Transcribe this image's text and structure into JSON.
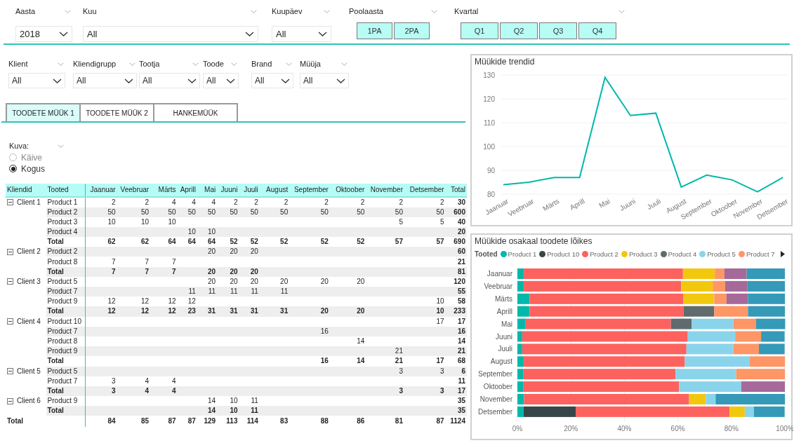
{
  "top_slicers": [
    {
      "kind": "dropdown",
      "label": "Aasta",
      "value": "2018"
    },
    {
      "kind": "dropdown",
      "label": "Kuu",
      "value": "All"
    },
    {
      "kind": "dropdown",
      "label": "Kuupäev",
      "value": "All"
    },
    {
      "kind": "buttons",
      "label": "Poolaasta",
      "buttons": [
        "1PA",
        "2PA"
      ]
    },
    {
      "kind": "buttons",
      "label": "Kvartal",
      "buttons": [
        "Q1",
        "Q2",
        "Q3",
        "Q4"
      ]
    }
  ],
  "filter_slicers": [
    {
      "label": "Klient",
      "value": "All"
    },
    {
      "label": "Kliendigrupp",
      "value": "All"
    },
    {
      "label": "Tootja",
      "value": "All"
    },
    {
      "label": "Toode",
      "value": "All"
    },
    {
      "label": "Brand",
      "value": "All"
    },
    {
      "label": "Müüja",
      "value": "All"
    }
  ],
  "tabs": [
    {
      "label": "TOODETE MÜÜK 1",
      "selected": true
    },
    {
      "label": "TOODETE MÜÜK 2",
      "selected": false
    },
    {
      "label": "HANKEMÜÜK",
      "selected": false
    }
  ],
  "view_slicer": {
    "label": "Kuva:",
    "options": [
      {
        "label": "Käive",
        "selected": false
      },
      {
        "label": "Kogus",
        "selected": true
      }
    ]
  },
  "table": {
    "columns": [
      "Kliendid",
      "Tooted",
      "Jaanuar",
      "Veebruar",
      "Märts",
      "Aprill",
      "Mai",
      "Juuni",
      "Juuli",
      "August",
      "September",
      "Oktoober",
      "November",
      "Detsember",
      "Total"
    ],
    "groups": [
      {
        "client": "Client 1",
        "expanded": true,
        "rows": [
          {
            "kind": "product",
            "cells": [
              "Product 1",
              "2",
              "2",
              "4",
              "4",
              "4",
              "2",
              "2",
              "2",
              "2",
              "2",
              "2",
              "2",
              "30"
            ]
          },
          {
            "kind": "product",
            "cells": [
              "Product 2",
              "50",
              "50",
              "50",
              "50",
              "50",
              "50",
              "50",
              "50",
              "50",
              "50",
              "50",
              "50",
              "600"
            ]
          },
          {
            "kind": "product",
            "cells": [
              "Product 3",
              "10",
              "10",
              "10",
              "",
              "",
              "",
              "",
              "",
              "",
              "",
              "5",
              "5",
              "40"
            ]
          },
          {
            "kind": "product",
            "cells": [
              "Product 4",
              "",
              "",
              "",
              "10",
              "10",
              "",
              "",
              "",
              "",
              "",
              "",
              "",
              "20"
            ]
          },
          {
            "kind": "total",
            "cells": [
              "Total",
              "62",
              "62",
              "64",
              "64",
              "64",
              "52",
              "52",
              "52",
              "52",
              "52",
              "57",
              "57",
              "690"
            ]
          }
        ]
      },
      {
        "client": "Client 2",
        "expanded": true,
        "rows": [
          {
            "kind": "product",
            "cells": [
              "Product 2",
              "",
              "",
              "",
              "",
              "20",
              "20",
              "20",
              "",
              "",
              "",
              "",
              "",
              "60"
            ]
          },
          {
            "kind": "product",
            "cells": [
              "Product 8",
              "7",
              "7",
              "7",
              "",
              "",
              "",
              "",
              "",
              "",
              "",
              "",
              "",
              "21"
            ]
          },
          {
            "kind": "total",
            "cells": [
              "Total",
              "7",
              "7",
              "7",
              "",
              "20",
              "20",
              "20",
              "",
              "",
              "",
              "",
              "",
              "81"
            ]
          }
        ]
      },
      {
        "client": "Client 3",
        "expanded": true,
        "rows": [
          {
            "kind": "product",
            "cells": [
              "Product 5",
              "",
              "",
              "",
              "",
              "20",
              "20",
              "20",
              "20",
              "20",
              "20",
              "",
              "",
              "120"
            ]
          },
          {
            "kind": "product",
            "cells": [
              "Product 7",
              "",
              "",
              "",
              "11",
              "11",
              "11",
              "11",
              "11",
              "",
              "",
              "",
              "",
              "55"
            ]
          },
          {
            "kind": "product",
            "cells": [
              "Product 9",
              "12",
              "12",
              "12",
              "12",
              "",
              "",
              "",
              "",
              "",
              "",
              "",
              "10",
              "58"
            ]
          },
          {
            "kind": "total",
            "cells": [
              "Total",
              "12",
              "12",
              "12",
              "23",
              "31",
              "31",
              "31",
              "31",
              "20",
              "20",
              "",
              "10",
              "233"
            ]
          }
        ]
      },
      {
        "client": "Client 4",
        "expanded": true,
        "rows": [
          {
            "kind": "product",
            "cells": [
              "Product 10",
              "",
              "",
              "",
              "",
              "",
              "",
              "",
              "",
              "",
              "",
              "",
              "17",
              "17"
            ]
          },
          {
            "kind": "product",
            "cells": [
              "Product 7",
              "",
              "",
              "",
              "",
              "",
              "",
              "",
              "",
              "16",
              "",
              "",
              "",
              "16"
            ]
          },
          {
            "kind": "product",
            "cells": [
              "Product 8",
              "",
              "",
              "",
              "",
              "",
              "",
              "",
              "",
              "",
              "14",
              "",
              "",
              "14"
            ]
          },
          {
            "kind": "product",
            "cells": [
              "Product 9",
              "",
              "",
              "",
              "",
              "",
              "",
              "",
              "",
              "",
              "",
              "21",
              "",
              "21"
            ]
          },
          {
            "kind": "total",
            "cells": [
              "Total",
              "",
              "",
              "",
              "",
              "",
              "",
              "",
              "",
              "16",
              "14",
              "21",
              "17",
              "68"
            ]
          }
        ]
      },
      {
        "client": "Client 5",
        "expanded": true,
        "rows": [
          {
            "kind": "product",
            "cells": [
              "Product 5",
              "",
              "",
              "",
              "",
              "",
              "",
              "",
              "",
              "",
              "",
              "3",
              "3",
              "6"
            ]
          },
          {
            "kind": "product",
            "cells": [
              "Product 7",
              "3",
              "4",
              "4",
              "",
              "",
              "",
              "",
              "",
              "",
              "",
              "",
              "",
              "11"
            ]
          },
          {
            "kind": "total",
            "cells": [
              "Total",
              "3",
              "4",
              "4",
              "",
              "",
              "",
              "",
              "",
              "",
              "",
              "3",
              "3",
              "17"
            ]
          }
        ]
      },
      {
        "client": "Client 6",
        "expanded": true,
        "rows": [
          {
            "kind": "product",
            "cells": [
              "Product 9",
              "",
              "",
              "",
              "",
              "14",
              "10",
              "11",
              "",
              "",
              "",
              "",
              "",
              "35"
            ]
          },
          {
            "kind": "total",
            "cells": [
              "Total",
              "",
              "",
              "",
              "",
              "14",
              "10",
              "11",
              "",
              "",
              "",
              "",
              "",
              "35"
            ]
          }
        ]
      }
    ],
    "grand_total": {
      "label": "Total",
      "cells": [
        "84",
        "85",
        "87",
        "87",
        "129",
        "113",
        "114",
        "83",
        "88",
        "86",
        "81",
        "87",
        "1124"
      ]
    }
  },
  "trend_chart": {
    "title": "Müükide trendid",
    "chart_data": {
      "type": "line",
      "categories": [
        "Jaanuar",
        "Veebruar",
        "Märts",
        "Aprill",
        "Mai",
        "Juuni",
        "Juuli",
        "August",
        "September",
        "Oktoober",
        "November",
        "Detsember"
      ],
      "series": [
        {
          "color": "#01b8aa",
          "values": [
            84,
            85,
            87,
            87,
            129,
            113,
            114,
            83,
            88,
            86,
            81,
            87
          ]
        }
      ],
      "ylim": [
        80,
        130
      ],
      "grid": true,
      "yticks": [
        80,
        90,
        100,
        110,
        120,
        130
      ]
    }
  },
  "share_chart": {
    "title": "Müükide osakaal toodete lõikes",
    "legend_title": "Tooted",
    "chart_data": {
      "type": "bar",
      "orientation": "horizontal",
      "stacked": true,
      "categories": [
        "Jaanuar",
        "Veebruar",
        "Märts",
        "Aprill",
        "Mai",
        "Juuni",
        "Juuli",
        "August",
        "September",
        "Oktoober",
        "November",
        "Detsember"
      ],
      "series": [
        {
          "name": "Product 1",
          "color": "#01b8aa",
          "values": [
            2.4,
            2.4,
            4.6,
            4.6,
            3.1,
            1.8,
            1.8,
            2.4,
            2.3,
            2.3,
            2.5,
            2.3
          ]
        },
        {
          "name": "Product 10",
          "color": "#374649",
          "values": [
            null,
            null,
            null,
            null,
            null,
            null,
            null,
            null,
            null,
            null,
            null,
            19.5
          ]
        },
        {
          "name": "Product 2",
          "color": "#fd625e",
          "values": [
            59.5,
            58.8,
            57.5,
            57.5,
            54.3,
            61.9,
            61.4,
            60.2,
            56.8,
            58.1,
            61.7,
            57.5
          ]
        },
        {
          "name": "Product 3",
          "color": "#f2c80f",
          "values": [
            11.9,
            11.8,
            11.5,
            null,
            null,
            null,
            null,
            null,
            null,
            null,
            6.2,
            5.7
          ]
        },
        {
          "name": "Product 4",
          "color": "#5f6b6d",
          "values": [
            null,
            null,
            null,
            11.5,
            7.8,
            null,
            null,
            null,
            null,
            null,
            null,
            null
          ]
        },
        {
          "name": "Product 5",
          "color": "#8ad4eb",
          "values": [
            null,
            null,
            null,
            null,
            15.5,
            17.7,
            17.5,
            24.1,
            22.7,
            23.3,
            3.7,
            3.4
          ]
        },
        {
          "name": "Product 7",
          "color": "#fe9666",
          "values": [
            3.6,
            4.7,
            4.6,
            12.6,
            8.5,
            9.7,
            9.6,
            13.3,
            18.2,
            null,
            null,
            null
          ]
        },
        {
          "color": "#a66999",
          "values": [
            8.3,
            8.2,
            8.0,
            null,
            null,
            null,
            null,
            null,
            null,
            16.3,
            null,
            null
          ]
        },
        {
          "color": "#3599b8",
          "values": [
            14.3,
            14.1,
            13.8,
            13.8,
            10.9,
            8.8,
            9.6,
            null,
            null,
            null,
            25.9,
            11.5
          ]
        }
      ],
      "xlim": [
        0,
        100
      ],
      "grid": true,
      "xticks": [
        {
          "value": 0,
          "label": "0%"
        },
        {
          "value": 20,
          "label": "20%"
        },
        {
          "value": 40,
          "label": "40%"
        },
        {
          "value": 60,
          "label": "60%"
        },
        {
          "value": 80,
          "label": "80%"
        },
        {
          "value": 100,
          "label": "100%"
        }
      ]
    }
  }
}
